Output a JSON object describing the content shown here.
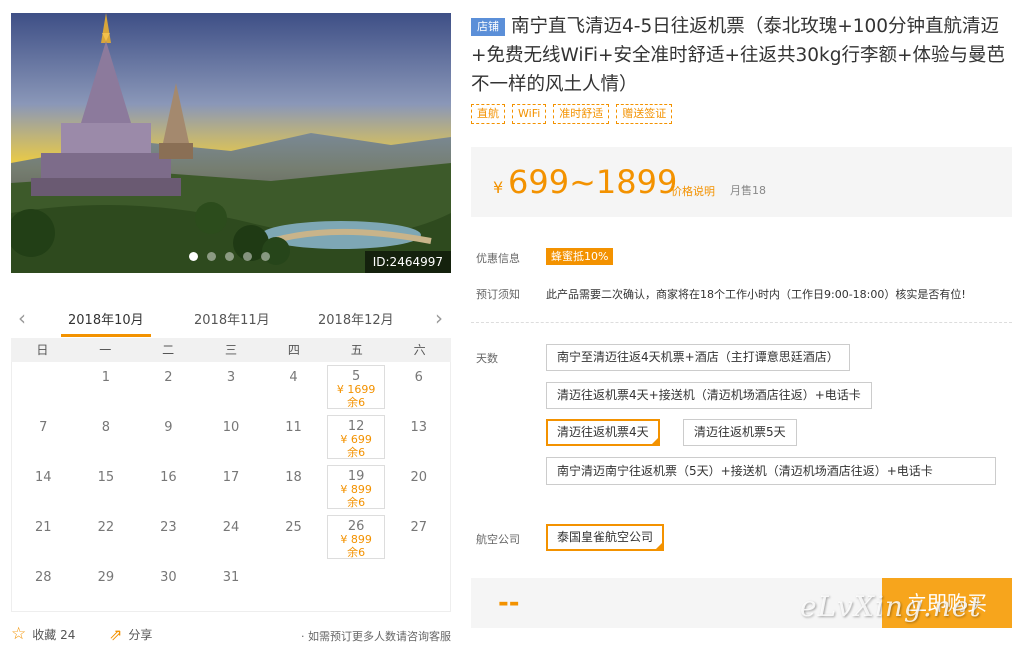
{
  "hero": {
    "id_label": "ID:2464997",
    "slides": 5,
    "active_slide": 1
  },
  "calendar": {
    "prev_icon": "chevron-left-icon",
    "next_icon": "chevron-right-icon",
    "months": [
      "2018年10月",
      "2018年11月",
      "2018年12月"
    ],
    "active_month": 0,
    "weekdays": [
      "日",
      "一",
      "二",
      "三",
      "四",
      "五",
      "六"
    ],
    "days": [
      {
        "day": ""
      },
      {
        "day": "1"
      },
      {
        "day": "2"
      },
      {
        "day": "3"
      },
      {
        "day": "4"
      },
      {
        "day": "5",
        "price": "¥ 1699",
        "remain": "余6"
      },
      {
        "day": "6"
      },
      {
        "day": "7"
      },
      {
        "day": "8"
      },
      {
        "day": "9"
      },
      {
        "day": "10"
      },
      {
        "day": "11"
      },
      {
        "day": "12",
        "price": "¥ 699",
        "remain": "余6"
      },
      {
        "day": "13"
      },
      {
        "day": "14"
      },
      {
        "day": "15"
      },
      {
        "day": "16"
      },
      {
        "day": "17"
      },
      {
        "day": "18"
      },
      {
        "day": "19",
        "price": "¥ 899",
        "remain": "余6"
      },
      {
        "day": "20"
      },
      {
        "day": "21"
      },
      {
        "day": "22"
      },
      {
        "day": "23"
      },
      {
        "day": "24"
      },
      {
        "day": "25"
      },
      {
        "day": "26",
        "price": "¥ 899",
        "remain": "余6"
      },
      {
        "day": "27"
      },
      {
        "day": "28"
      },
      {
        "day": "29"
      },
      {
        "day": "30"
      },
      {
        "day": "31"
      },
      {
        "day": ""
      },
      {
        "day": ""
      },
      {
        "day": ""
      }
    ]
  },
  "actions": {
    "favorite_label": "收藏 24",
    "share_label": "分享",
    "note": "· 如需预订更多人数请咨询客服"
  },
  "product": {
    "shop_badge": "店铺",
    "title": "南宁直飞清迈4-5日往返机票（泰北玫瑰+100分钟直航清迈+免费无线WiFi+安全准时舒适+往返共30kg行李额+体验与曼芭不一样的风土人情）",
    "tags": [
      "直航",
      "WiFi",
      "准时舒适",
      "赠送签证"
    ]
  },
  "price": {
    "currency": "¥",
    "range": "699~1899",
    "explain_link": "价格说明",
    "monthly_sales": "月售18"
  },
  "info": {
    "discount_label": "优惠信息",
    "discount_value": "蜂蜜抵10%",
    "booking_label": "预订须知",
    "booking_value": "此产品需要二次确认，商家将在18个工作小时内（工作日9:00-18:00）核实是否有位!"
  },
  "options": {
    "days_label": "天数",
    "days_options": [
      "南宁至清迈往返4天机票+酒店（主打谭意思廷酒店）",
      "清迈往返机票4天+接送机（清迈机场酒店往返）+电话卡",
      "清迈往返机票4天",
      "清迈往返机票5天",
      "南宁清迈南宁往返机票（5天）+接送机（清迈机场酒店往返）+电话卡"
    ],
    "selected_day_option": 2,
    "airline_label": "航空公司",
    "airline_options": [
      "泰国皇雀航空公司"
    ],
    "selected_airline": 0
  },
  "purchase": {
    "total": "--",
    "buy_label": "立即购买"
  },
  "watermark": "eLvXing.net",
  "colors": {
    "accent": "#f39200",
    "shop_badge": "#5b8fd8",
    "buy_button": "#f7a51c"
  }
}
